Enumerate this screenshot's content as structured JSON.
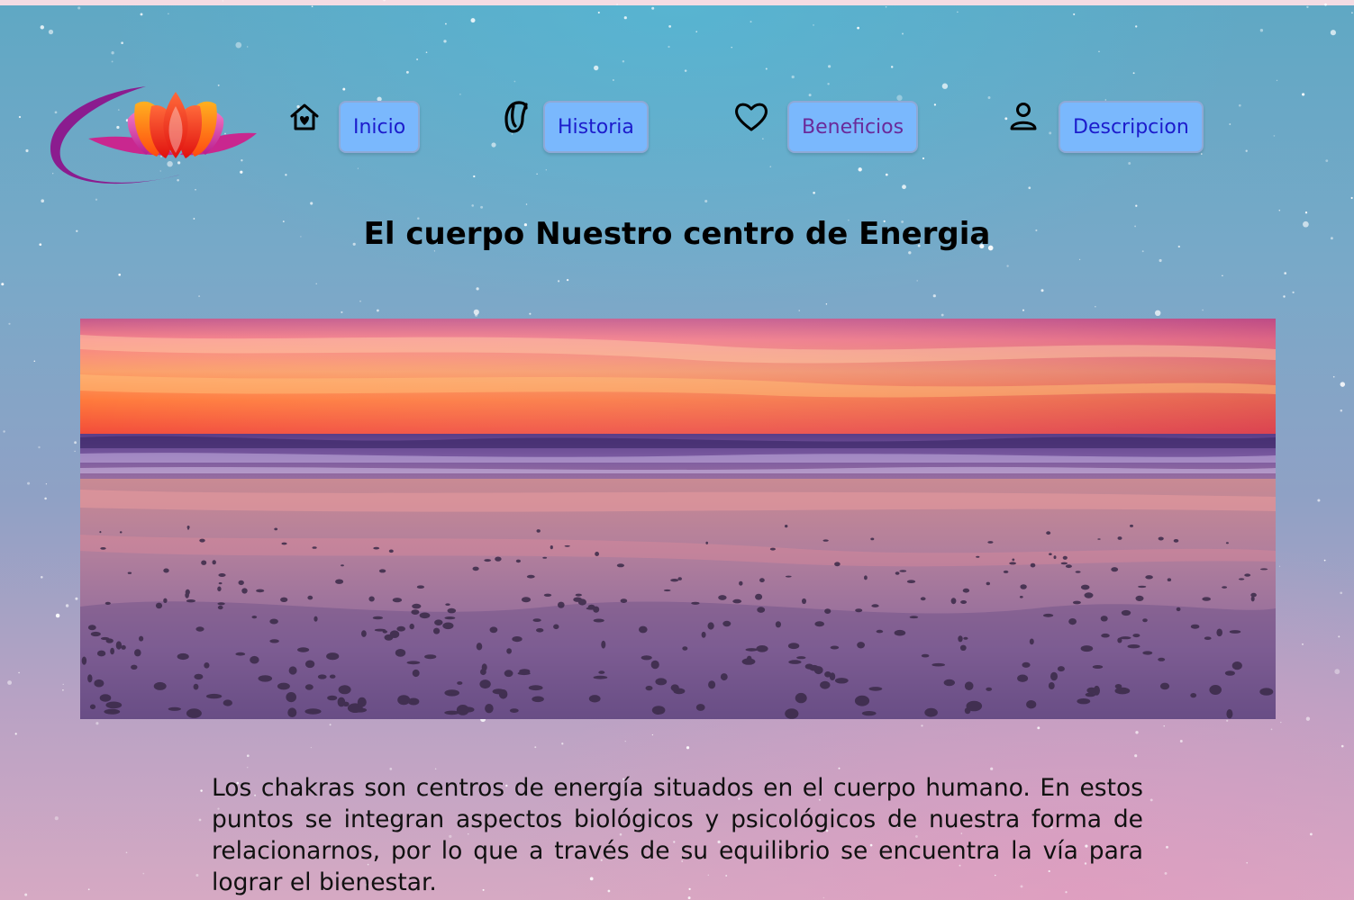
{
  "nav": {
    "items": [
      {
        "label": "Inicio",
        "icon": "home-heart-icon"
      },
      {
        "label": "Historia",
        "icon": "scroll-icon"
      },
      {
        "label": "Beneficios",
        "icon": "heart-icon"
      },
      {
        "label": "Descripcion",
        "icon": "person-icon"
      }
    ]
  },
  "page": {
    "title": "El cuerpo Nuestro centro de Energia",
    "description": "Los chakras son centros de energía situados en el cuerpo humano. En estos puntos se integran aspectos biológicos y psicológicos de nuestra forma de relacionarnos, por lo que a través de su equilibrio se encuentra la vía para lograr el bienestar."
  },
  "colors": {
    "button_bg": "#7ab8fd",
    "button_text": "#1c1ccc",
    "logo_purple": "#8b1c8f",
    "logo_pink": "#d5399e",
    "logo_orange": "#ff7a10"
  }
}
